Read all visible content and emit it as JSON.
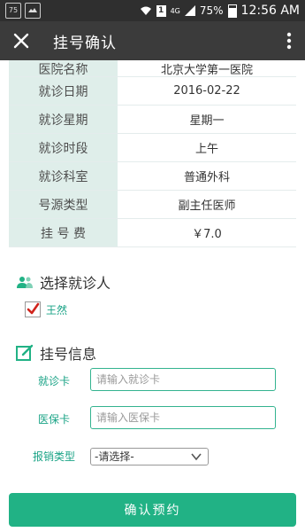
{
  "status_bar": {
    "notif1": "75",
    "network": "4G",
    "battery": "75%",
    "time": "12:56 AM"
  },
  "app_bar": {
    "title": "挂号确认"
  },
  "info": {
    "rows": [
      {
        "label": "医院名称",
        "value": "北京大学第一医院"
      },
      {
        "label": "就诊日期",
        "value": "2016-02-22"
      },
      {
        "label": "就诊星期",
        "value": "星期一"
      },
      {
        "label": "就诊时段",
        "value": "上午"
      },
      {
        "label": "就诊科室",
        "value": "普通外科"
      },
      {
        "label": "号源类型",
        "value": "副主任医师"
      },
      {
        "label": "挂 号 费",
        "value": "￥7.0"
      }
    ]
  },
  "patient": {
    "section_title": "选择就诊人",
    "name": "王然",
    "checked": true
  },
  "registration": {
    "section_title": "挂号信息",
    "card_label": "就诊卡",
    "card_placeholder": "请输入就诊卡",
    "insurance_label": "医保卡",
    "insurance_placeholder": "请输入医保卡",
    "reimb_label": "报销类型",
    "reimb_selected": "-请选择-"
  },
  "confirm_button": "确认预约",
  "colors": {
    "accent": "#21b285",
    "label_bg": "#dfeeea",
    "appbar": "#3b3b3b"
  }
}
